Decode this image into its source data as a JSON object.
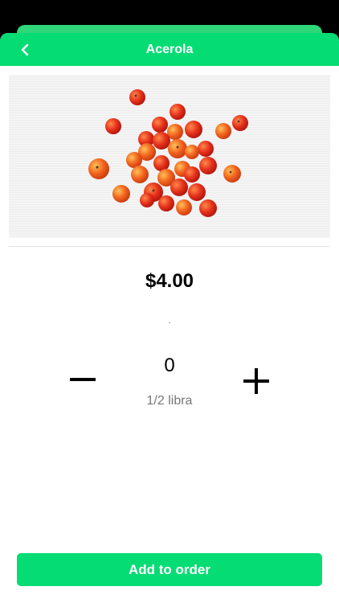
{
  "header": {
    "title": "Acerola",
    "back_icon": "chevron-left-icon"
  },
  "product": {
    "image_name": "acerola-cherries-photo",
    "price": "$4.00",
    "description": "."
  },
  "quantity": {
    "value": "0",
    "unit": "1/2 libra",
    "decrease_icon": "minus-icon",
    "increase_icon": "plus-icon"
  },
  "footer": {
    "add_label": "Add to order"
  },
  "colors": {
    "accent": "#06dc74"
  }
}
